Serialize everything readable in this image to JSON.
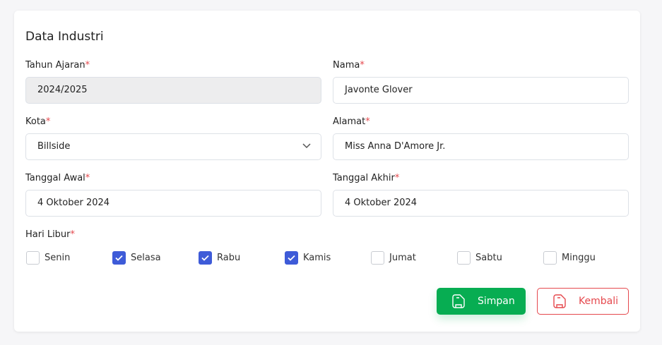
{
  "card": {
    "title": "Data Industri"
  },
  "fields": {
    "tahun_ajaran": {
      "label": "Tahun Ajaran",
      "value": "2024/2025"
    },
    "nama": {
      "label": "Nama",
      "value": "Javonte Glover"
    },
    "kota": {
      "label": "Kota",
      "value": "Billside"
    },
    "alamat": {
      "label": "Alamat",
      "value": "Miss Anna D'Amore Jr."
    },
    "tanggal_awal": {
      "label": "Tanggal Awal",
      "value": "4 Oktober 2024"
    },
    "tanggal_akhir": {
      "label": "Tanggal Akhir",
      "value": "4 Oktober 2024"
    },
    "required_mark": "*"
  },
  "hari_libur": {
    "label": "Hari Libur",
    "days": [
      {
        "label": "Senin",
        "checked": false
      },
      {
        "label": "Selasa",
        "checked": true
      },
      {
        "label": "Rabu",
        "checked": true
      },
      {
        "label": "Kamis",
        "checked": true
      },
      {
        "label": "Jumat",
        "checked": false
      },
      {
        "label": "Sabtu",
        "checked": false
      },
      {
        "label": "Minggu",
        "checked": false
      }
    ]
  },
  "buttons": {
    "save": "Simpan",
    "back": "Kembali"
  },
  "colors": {
    "accent": "#3e5bd8",
    "success": "#07ad52",
    "danger": "#e5484d"
  }
}
